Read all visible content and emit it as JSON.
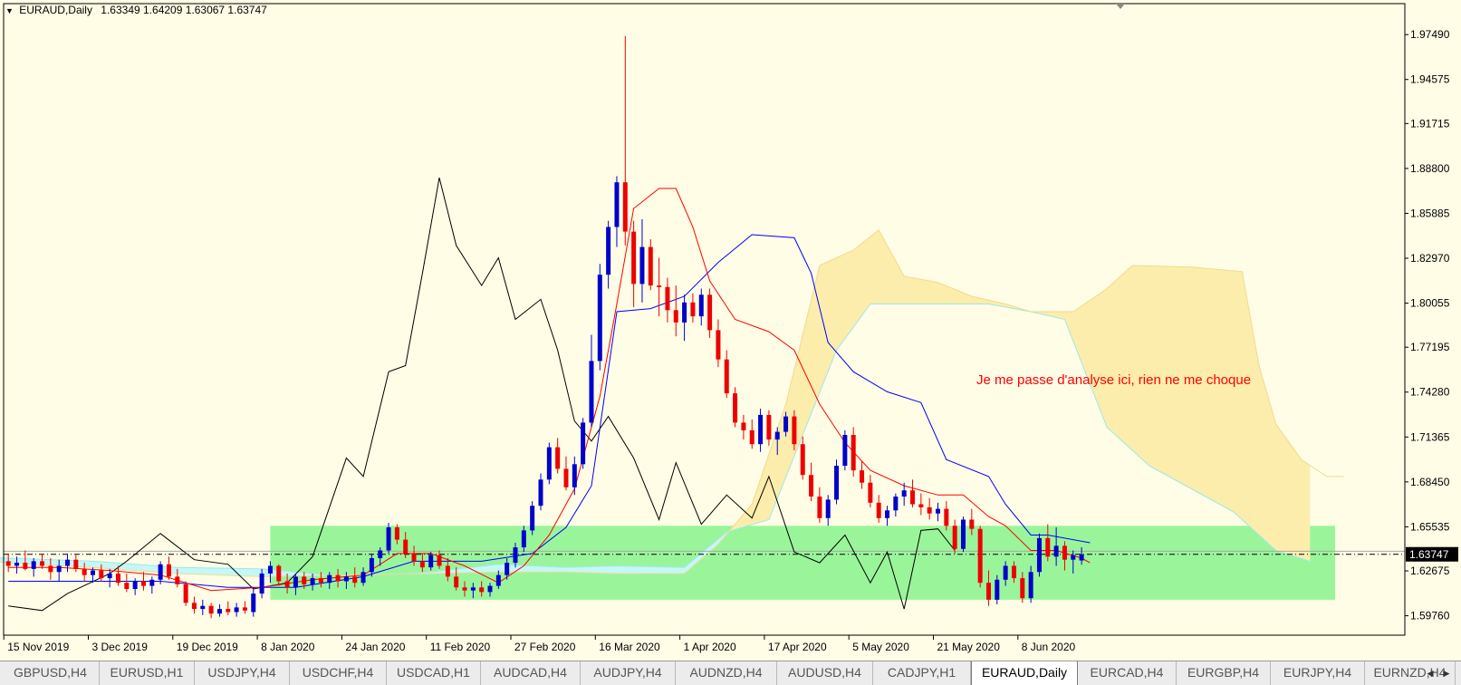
{
  "header": {
    "symbol": "EURAUD,Daily",
    "ohlc": "1.63349 1.64209 1.63067 1.63747"
  },
  "annotation": "Je me passe d'analyse ici, rien ne me choque",
  "price_axis": [
    "1.97490",
    "1.94575",
    "1.91715",
    "1.88800",
    "1.85885",
    "1.82970",
    "1.80055",
    "1.77195",
    "1.74280",
    "1.71365",
    "1.68450",
    "1.65535",
    "1.62675",
    "1.59760"
  ],
  "current_price": "1.63747",
  "time_axis": [
    "15 Nov 2019",
    "3 Dec 2019",
    "19 Dec 2019",
    "8 Jan 2020",
    "24 Jan 2020",
    "11 Feb 2020",
    "27 Feb 2020",
    "16 Mar 2020",
    "1 Apr 2020",
    "17 Apr 2020",
    "5 May 2020",
    "21 May 2020",
    "8 Jun 2020"
  ],
  "tabs": [
    "GBPUSD,H4",
    "EURUSD,H1",
    "USDJPY,H4",
    "USDCHF,H4",
    "USDCAD,H1",
    "AUDCAD,H4",
    "AUDJPY,H4",
    "AUDNZD,H4",
    "AUDUSD,H4",
    "CADJPY,H1",
    "EURAUD,Daily",
    "EURCAD,H4",
    "EURGBP,H4",
    "EURJPY,H4",
    "EURNZD,H4"
  ],
  "active_tab": "EURAUD,Daily",
  "colors": {
    "background": "#fffde6",
    "bull": "#0000cc",
    "bear": "#ee0000",
    "tenkan": "#ff0000",
    "kijun": "#0000ff",
    "chikou": "#000000",
    "cloud_up": "#c4f8f8",
    "cloud_down": "#fcedac",
    "zone": "#9af59a"
  },
  "chart_data": {
    "type": "candlestick",
    "ylim": [
      1.585,
      1.995
    ],
    "candles": [
      [
        1.633,
        1.638,
        1.626,
        1.63
      ],
      [
        1.63,
        1.636,
        1.625,
        1.632
      ],
      [
        1.632,
        1.64,
        1.627,
        1.628
      ],
      [
        1.628,
        1.635,
        1.623,
        1.633
      ],
      [
        1.633,
        1.638,
        1.628,
        1.63
      ],
      [
        1.63,
        1.635,
        1.621,
        1.626
      ],
      [
        1.626,
        1.634,
        1.62,
        1.63
      ],
      [
        1.63,
        1.638,
        1.626,
        1.634
      ],
      [
        1.634,
        1.637,
        1.626,
        1.628
      ],
      [
        1.628,
        1.632,
        1.62,
        1.624
      ],
      [
        1.624,
        1.629,
        1.619,
        1.627
      ],
      [
        1.627,
        1.631,
        1.62,
        1.622
      ],
      [
        1.622,
        1.628,
        1.616,
        1.625
      ],
      [
        1.625,
        1.63,
        1.617,
        1.619
      ],
      [
        1.619,
        1.625,
        1.613,
        1.615
      ],
      [
        1.615,
        1.622,
        1.611,
        1.62
      ],
      [
        1.62,
        1.626,
        1.614,
        1.617
      ],
      [
        1.617,
        1.623,
        1.612,
        1.621
      ],
      [
        1.621,
        1.633,
        1.618,
        1.631
      ],
      [
        1.631,
        1.636,
        1.621,
        1.623
      ],
      [
        1.623,
        1.628,
        1.616,
        1.618
      ],
      [
        1.618,
        1.62,
        1.604,
        1.606
      ],
      [
        1.606,
        1.61,
        1.599,
        1.602
      ],
      [
        1.602,
        1.608,
        1.598,
        1.604
      ],
      [
        1.604,
        1.606,
        1.596,
        1.599
      ],
      [
        1.599,
        1.605,
        1.597,
        1.602
      ],
      [
        1.602,
        1.607,
        1.598,
        1.6
      ],
      [
        1.6,
        1.606,
        1.597,
        1.603
      ],
      [
        1.603,
        1.607,
        1.599,
        1.601
      ],
      [
        1.6,
        1.616,
        1.597,
        1.612
      ],
      [
        1.612,
        1.628,
        1.609,
        1.625
      ],
      [
        1.625,
        1.633,
        1.619,
        1.63
      ],
      [
        1.63,
        1.631,
        1.617,
        1.62
      ],
      [
        1.62,
        1.625,
        1.612,
        1.616
      ],
      [
        1.616,
        1.625,
        1.611,
        1.623
      ],
      [
        1.623,
        1.626,
        1.615,
        1.618
      ],
      [
        1.618,
        1.625,
        1.614,
        1.622
      ],
      [
        1.622,
        1.626,
        1.616,
        1.619
      ],
      [
        1.619,
        1.626,
        1.615,
        1.624
      ],
      [
        1.624,
        1.628,
        1.616,
        1.62
      ],
      [
        1.62,
        1.626,
        1.615,
        1.623
      ],
      [
        1.623,
        1.629,
        1.616,
        1.619
      ],
      [
        1.619,
        1.629,
        1.617,
        1.626
      ],
      [
        1.626,
        1.638,
        1.623,
        1.635
      ],
      [
        1.635,
        1.642,
        1.63,
        1.64
      ],
      [
        1.64,
        1.658,
        1.638,
        1.655
      ],
      [
        1.655,
        1.657,
        1.644,
        1.647
      ],
      [
        1.647,
        1.652,
        1.635,
        1.638
      ],
      [
        1.638,
        1.643,
        1.63,
        1.633
      ],
      [
        1.633,
        1.638,
        1.626,
        1.629
      ],
      [
        1.629,
        1.639,
        1.627,
        1.637
      ],
      [
        1.637,
        1.64,
        1.628,
        1.63
      ],
      [
        1.63,
        1.635,
        1.62,
        1.623
      ],
      [
        1.623,
        1.629,
        1.614,
        1.616
      ],
      [
        1.616,
        1.62,
        1.61,
        1.614
      ],
      [
        1.614,
        1.619,
        1.609,
        1.616
      ],
      [
        1.616,
        1.62,
        1.61,
        1.613
      ],
      [
        1.613,
        1.619,
        1.61,
        1.617
      ],
      [
        1.617,
        1.627,
        1.615,
        1.624
      ],
      [
        1.624,
        1.635,
        1.621,
        1.632
      ],
      [
        1.632,
        1.645,
        1.629,
        1.642
      ],
      [
        1.642,
        1.656,
        1.639,
        1.653
      ],
      [
        1.653,
        1.672,
        1.65,
        1.669
      ],
      [
        1.669,
        1.69,
        1.666,
        1.686
      ],
      [
        1.686,
        1.71,
        1.683,
        1.707
      ],
      [
        1.707,
        1.713,
        1.69,
        1.693
      ],
      [
        1.693,
        1.701,
        1.679,
        1.681
      ],
      [
        1.681,
        1.701,
        1.676,
        1.696
      ],
      [
        1.696,
        1.726,
        1.693,
        1.723
      ],
      [
        1.723,
        1.78,
        1.72,
        1.763
      ],
      [
        1.763,
        1.826,
        1.757,
        1.819
      ],
      [
        1.819,
        1.854,
        1.81,
        1.85
      ],
      [
        1.85,
        1.883,
        1.837,
        1.879
      ],
      [
        1.879,
        1.974,
        1.838,
        1.847
      ],
      [
        1.847,
        1.854,
        1.798,
        1.813
      ],
      [
        1.813,
        1.855,
        1.801,
        1.837
      ],
      [
        1.837,
        1.842,
        1.809,
        1.812
      ],
      [
        1.812,
        1.83,
        1.792,
        1.811
      ],
      [
        1.811,
        1.817,
        1.788,
        1.796
      ],
      [
        1.796,
        1.812,
        1.779,
        1.788
      ],
      [
        1.788,
        1.806,
        1.776,
        1.801
      ],
      [
        1.801,
        1.807,
        1.788,
        1.792
      ],
      [
        1.792,
        1.81,
        1.786,
        1.806
      ],
      [
        1.806,
        1.81,
        1.778,
        1.783
      ],
      [
        1.783,
        1.79,
        1.759,
        1.764
      ],
      [
        1.764,
        1.77,
        1.739,
        1.742
      ],
      [
        1.742,
        1.746,
        1.72,
        1.723
      ],
      [
        1.723,
        1.728,
        1.712,
        1.718
      ],
      [
        1.718,
        1.725,
        1.706,
        1.709
      ],
      [
        1.709,
        1.732,
        1.704,
        1.728
      ],
      [
        1.728,
        1.731,
        1.708,
        1.712
      ],
      [
        1.712,
        1.72,
        1.702,
        1.717
      ],
      [
        1.717,
        1.73,
        1.714,
        1.727
      ],
      [
        1.727,
        1.731,
        1.705,
        1.709
      ],
      [
        1.709,
        1.714,
        1.686,
        1.689
      ],
      [
        1.689,
        1.697,
        1.672,
        1.675
      ],
      [
        1.675,
        1.681,
        1.658,
        1.661
      ],
      [
        1.661,
        1.676,
        1.656,
        1.673
      ],
      [
        1.673,
        1.699,
        1.67,
        1.695
      ],
      [
        1.695,
        1.718,
        1.692,
        1.715
      ],
      [
        1.715,
        1.72,
        1.688,
        1.692
      ],
      [
        1.692,
        1.698,
        1.68,
        1.684
      ],
      [
        1.684,
        1.689,
        1.668,
        1.671
      ],
      [
        1.671,
        1.676,
        1.658,
        1.661
      ],
      [
        1.661,
        1.669,
        1.656,
        1.666
      ],
      [
        1.666,
        1.677,
        1.662,
        1.675
      ],
      [
        1.675,
        1.684,
        1.669,
        1.679
      ],
      [
        1.679,
        1.686,
        1.668,
        1.67
      ],
      [
        1.67,
        1.677,
        1.663,
        1.668
      ],
      [
        1.668,
        1.674,
        1.66,
        1.664
      ],
      [
        1.664,
        1.671,
        1.659,
        1.667
      ],
      [
        1.667,
        1.672,
        1.653,
        1.656
      ],
      [
        1.656,
        1.66,
        1.638,
        1.641
      ],
      [
        1.641,
        1.662,
        1.639,
        1.66
      ],
      [
        1.66,
        1.667,
        1.65,
        1.654
      ],
      [
        1.654,
        1.656,
        1.616,
        1.619
      ],
      [
        1.619,
        1.627,
        1.604,
        1.608
      ],
      [
        1.608,
        1.624,
        1.605,
        1.621
      ],
      [
        1.621,
        1.633,
        1.617,
        1.63
      ],
      [
        1.63,
        1.633,
        1.619,
        1.622
      ],
      [
        1.622,
        1.626,
        1.606,
        1.609
      ],
      [
        1.609,
        1.63,
        1.606,
        1.626
      ],
      [
        1.626,
        1.651,
        1.623,
        1.648
      ],
      [
        1.648,
        1.657,
        1.633,
        1.636
      ],
      [
        1.636,
        1.655,
        1.63,
        1.643
      ],
      [
        1.643,
        1.646,
        1.627,
        1.634
      ],
      [
        1.634,
        1.64,
        1.625,
        1.637
      ],
      [
        1.6335,
        1.6421,
        1.6307,
        1.6375
      ]
    ],
    "tenkan": [
      [
        0,
        1.629
      ],
      [
        6,
        1.629
      ],
      [
        12,
        1.627
      ],
      [
        18,
        1.624
      ],
      [
        24,
        1.614
      ],
      [
        30,
        1.616
      ],
      [
        36,
        1.621
      ],
      [
        42,
        1.624
      ],
      [
        46,
        1.638
      ],
      [
        50,
        1.638
      ],
      [
        54,
        1.63
      ],
      [
        58,
        1.619
      ],
      [
        61,
        1.63
      ],
      [
        64,
        1.65
      ],
      [
        67,
        1.68
      ],
      [
        70,
        1.74
      ],
      [
        72,
        1.8
      ],
      [
        74,
        1.862
      ],
      [
        77,
        1.875
      ],
      [
        79,
        1.875
      ],
      [
        81,
        1.85
      ],
      [
        83,
        1.815
      ],
      [
        86,
        1.79
      ],
      [
        90,
        1.782
      ],
      [
        93,
        1.77
      ],
      [
        96,
        1.735
      ],
      [
        99,
        1.71
      ],
      [
        102,
        1.692
      ],
      [
        106,
        1.682
      ],
      [
        110,
        1.676
      ],
      [
        113,
        1.676
      ],
      [
        116,
        1.662
      ],
      [
        118,
        1.656
      ],
      [
        121,
        1.64
      ],
      [
        124,
        1.64
      ],
      [
        127,
        1.635
      ],
      [
        128,
        1.632
      ]
    ],
    "kijun": [
      [
        0,
        1.62
      ],
      [
        8,
        1.62
      ],
      [
        18,
        1.62
      ],
      [
        26,
        1.616
      ],
      [
        34,
        1.616
      ],
      [
        42,
        1.623
      ],
      [
        48,
        1.633
      ],
      [
        56,
        1.633
      ],
      [
        62,
        1.638
      ],
      [
        66,
        1.655
      ],
      [
        69,
        1.682
      ],
      [
        72,
        1.795
      ],
      [
        76,
        1.797
      ],
      [
        80,
        1.805
      ],
      [
        84,
        1.827
      ],
      [
        88,
        1.845
      ],
      [
        93,
        1.843
      ],
      [
        95,
        1.82
      ],
      [
        97,
        1.775
      ],
      [
        100,
        1.756
      ],
      [
        104,
        1.743
      ],
      [
        108,
        1.736
      ],
      [
        111,
        1.699
      ],
      [
        116,
        1.688
      ],
      [
        118,
        1.67
      ],
      [
        121,
        1.65
      ],
      [
        123,
        1.65
      ],
      [
        128,
        1.645
      ]
    ],
    "chikou": [
      [
        0,
        1.604
      ],
      [
        4,
        1.601
      ],
      [
        7,
        1.612
      ],
      [
        12,
        1.625
      ],
      [
        14,
        1.633
      ],
      [
        18,
        1.651
      ],
      [
        22,
        1.634
      ],
      [
        26,
        1.631
      ],
      [
        29,
        1.615
      ],
      [
        33,
        1.619
      ],
      [
        36,
        1.636
      ],
      [
        40,
        1.7
      ],
      [
        42,
        1.688
      ],
      [
        45,
        1.756
      ],
      [
        47,
        1.76
      ],
      [
        49,
        1.82
      ],
      [
        51,
        1.882
      ],
      [
        53,
        1.838
      ],
      [
        56,
        1.812
      ],
      [
        58,
        1.83
      ],
      [
        60,
        1.79
      ],
      [
        63,
        1.803
      ],
      [
        65,
        1.77
      ],
      [
        67,
        1.724
      ],
      [
        69,
        1.711
      ],
      [
        71,
        1.727
      ],
      [
        74,
        1.7
      ],
      [
        77,
        1.66
      ],
      [
        79,
        1.697
      ],
      [
        82,
        1.657
      ],
      [
        85,
        1.676
      ],
      [
        88,
        1.661
      ],
      [
        90,
        1.688
      ],
      [
        93,
        1.639
      ],
      [
        96,
        1.632
      ],
      [
        99,
        1.65
      ],
      [
        102,
        1.619
      ],
      [
        104,
        1.639
      ],
      [
        106,
        1.602
      ],
      [
        108,
        1.653
      ],
      [
        110,
        1.654
      ],
      [
        112,
        1.64
      ]
    ],
    "senkou_a": [
      [
        -10,
        1.637
      ],
      [
        0,
        1.635
      ],
      [
        10,
        1.633
      ],
      [
        20,
        1.629
      ],
      [
        30,
        1.628
      ],
      [
        40,
        1.623
      ],
      [
        50,
        1.626
      ],
      [
        58,
        1.631
      ],
      [
        66,
        1.629
      ],
      [
        72,
        1.63
      ],
      [
        80,
        1.629
      ],
      [
        85,
        1.652
      ],
      [
        90,
        1.66
      ],
      [
        94,
        1.715
      ],
      [
        98,
        1.77
      ],
      [
        102,
        1.8
      ],
      [
        110,
        1.8
      ],
      [
        116,
        1.8
      ],
      [
        121,
        1.795
      ],
      [
        125,
        1.79
      ],
      [
        130,
        1.72
      ],
      [
        135,
        1.695
      ],
      [
        140,
        1.68
      ],
      [
        145,
        1.665
      ],
      [
        150,
        1.64
      ],
      [
        154,
        1.633
      ]
    ],
    "senkou_b": [
      [
        -10,
        1.637
      ],
      [
        0,
        1.632
      ],
      [
        10,
        1.629
      ],
      [
        20,
        1.625
      ],
      [
        30,
        1.623
      ],
      [
        40,
        1.624
      ],
      [
        50,
        1.625
      ],
      [
        58,
        1.626
      ],
      [
        66,
        1.626
      ],
      [
        72,
        1.625
      ],
      [
        80,
        1.625
      ],
      [
        84,
        1.644
      ],
      [
        88,
        1.67
      ],
      [
        92,
        1.735
      ],
      [
        96,
        1.825
      ],
      [
        100,
        1.835
      ],
      [
        103,
        1.848
      ],
      [
        106,
        1.818
      ],
      [
        110,
        1.814
      ],
      [
        114,
        1.805
      ],
      [
        118,
        1.8
      ],
      [
        121,
        1.795
      ],
      [
        126,
        1.795
      ],
      [
        130,
        1.81
      ],
      [
        133,
        1.825
      ],
      [
        140,
        1.824
      ],
      [
        146,
        1.821
      ],
      [
        148,
        1.76
      ],
      [
        150,
        1.722
      ],
      [
        153,
        1.699
      ],
      [
        156,
        1.688
      ],
      [
        158,
        1.688
      ]
    ],
    "support_zone": [
      1.608,
      1.656
    ]
  }
}
